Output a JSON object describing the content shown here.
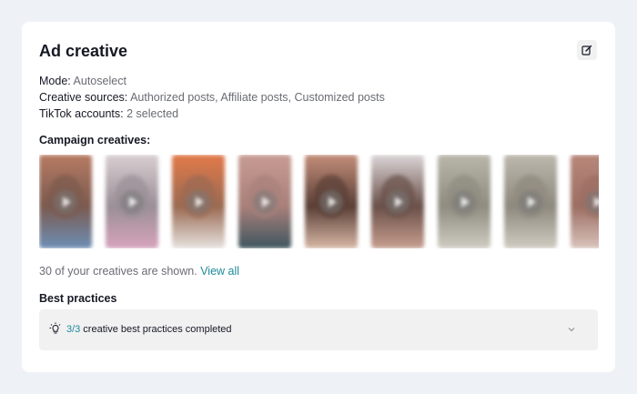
{
  "card": {
    "title": "Ad creative",
    "edit_icon": "edit-icon"
  },
  "info": {
    "mode_label": "Mode:",
    "mode_value": "Autoselect",
    "sources_label": "Creative sources:",
    "sources_value": "Authorized posts, Affiliate posts, Customized posts",
    "accounts_label": "TikTok accounts:",
    "accounts_value": "2 selected"
  },
  "campaign": {
    "label": "Campaign creatives:",
    "thumbnails": [
      {
        "name": "creative-1",
        "colors": [
          "#b77b63",
          "#7b5a4f",
          "#6d8fb6"
        ]
      },
      {
        "name": "creative-2",
        "colors": [
          "#d9cfd2",
          "#9a8f96",
          "#d7a4bd"
        ]
      },
      {
        "name": "creative-3",
        "colors": [
          "#e27a4a",
          "#9a6a52",
          "#e7e3e0"
        ]
      },
      {
        "name": "creative-4",
        "colors": [
          "#c79c93",
          "#a9807a",
          "#3f5660"
        ]
      },
      {
        "name": "creative-5",
        "colors": [
          "#c48e7a",
          "#5a3f36",
          "#d8b8a6"
        ]
      },
      {
        "name": "creative-6",
        "colors": [
          "#dcd6d8",
          "#6a5049",
          "#c79f8f"
        ]
      },
      {
        "name": "creative-7",
        "colors": [
          "#b9b6aa",
          "#8f8c80",
          "#cfccc2"
        ]
      },
      {
        "name": "creative-8",
        "colors": [
          "#bdb8ad",
          "#8e897e",
          "#d0ccc2"
        ]
      },
      {
        "name": "creative-9",
        "colors": [
          "#b8877a",
          "#9c6e63",
          "#d9c4bd"
        ]
      }
    ],
    "shown_text": "30 of your creatives are shown.",
    "view_all": "View all"
  },
  "best_practices": {
    "label": "Best practices",
    "count": "3/3",
    "text": "creative best practices completed",
    "icon": "lightbulb-icon",
    "chevron": "chevron-down-icon"
  }
}
